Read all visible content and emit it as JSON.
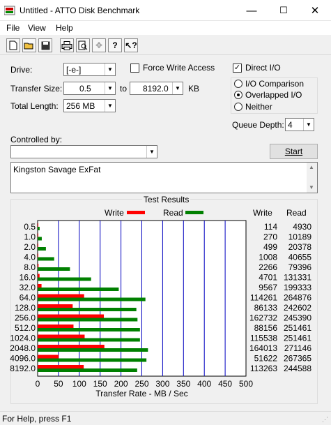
{
  "window": {
    "title": "Untitled - ATTO Disk Benchmark",
    "minimize": "—",
    "maximize": "☐",
    "close": "✕"
  },
  "menu": [
    "File",
    "View",
    "Help"
  ],
  "form": {
    "drive_label": "Drive:",
    "drive_value": "[-e-]",
    "transfer_size_label": "Transfer Size:",
    "transfer_from": "0.5",
    "to_label": "to",
    "transfer_to": "8192.0",
    "kb_label": "KB",
    "total_length_label": "Total Length:",
    "total_length_value": "256 MB",
    "force_write_label": "Force Write Access",
    "force_write_checked": false,
    "direct_io_label": "Direct I/O",
    "direct_io_checked": true,
    "io_comparison_label": "I/O Comparison",
    "overlapped_io_label": "Overlapped I/O",
    "neither_label": "Neither",
    "selected_mode": "Overlapped I/O",
    "queue_depth_label": "Queue Depth:",
    "queue_depth_value": "4",
    "controlled_by_label": "Controlled by:",
    "controlled_by_value": "",
    "start_label": "Start",
    "description": "Kingston Savage ExFat"
  },
  "results": {
    "title": "Test Results",
    "legend_write": "Write",
    "legend_read": "Read",
    "col_write": "Write",
    "col_read": "Read"
  },
  "chart_data": {
    "type": "bar",
    "orientation": "horizontal",
    "categories": [
      "0.5",
      "1.0",
      "2.0",
      "4.0",
      "8.0",
      "16.0",
      "32.0",
      "64.0",
      "128.0",
      "256.0",
      "512.0",
      "1024.0",
      "2048.0",
      "4096.0",
      "8192.0"
    ],
    "series": [
      {
        "name": "Write",
        "color": "#ff0000",
        "values": [
          114,
          270,
          499,
          1008,
          2266,
          4701,
          9567,
          114261,
          86133,
          162732,
          88156,
          115538,
          164013,
          51622,
          113263
        ]
      },
      {
        "name": "Read",
        "color": "#008000",
        "values": [
          4930,
          10189,
          20378,
          40655,
          79396,
          131331,
          199333,
          264876,
          242602,
          245390,
          251461,
          251461,
          271146,
          267365,
          244588
        ]
      }
    ],
    "xlabel": "Transfer Rate - MB / Sec",
    "xticks": [
      0,
      50,
      100,
      150,
      200,
      250,
      300,
      350,
      400,
      450,
      500
    ],
    "xlim": [
      0,
      500
    ],
    "grid": true
  },
  "status": {
    "text": "For Help, press F1"
  }
}
